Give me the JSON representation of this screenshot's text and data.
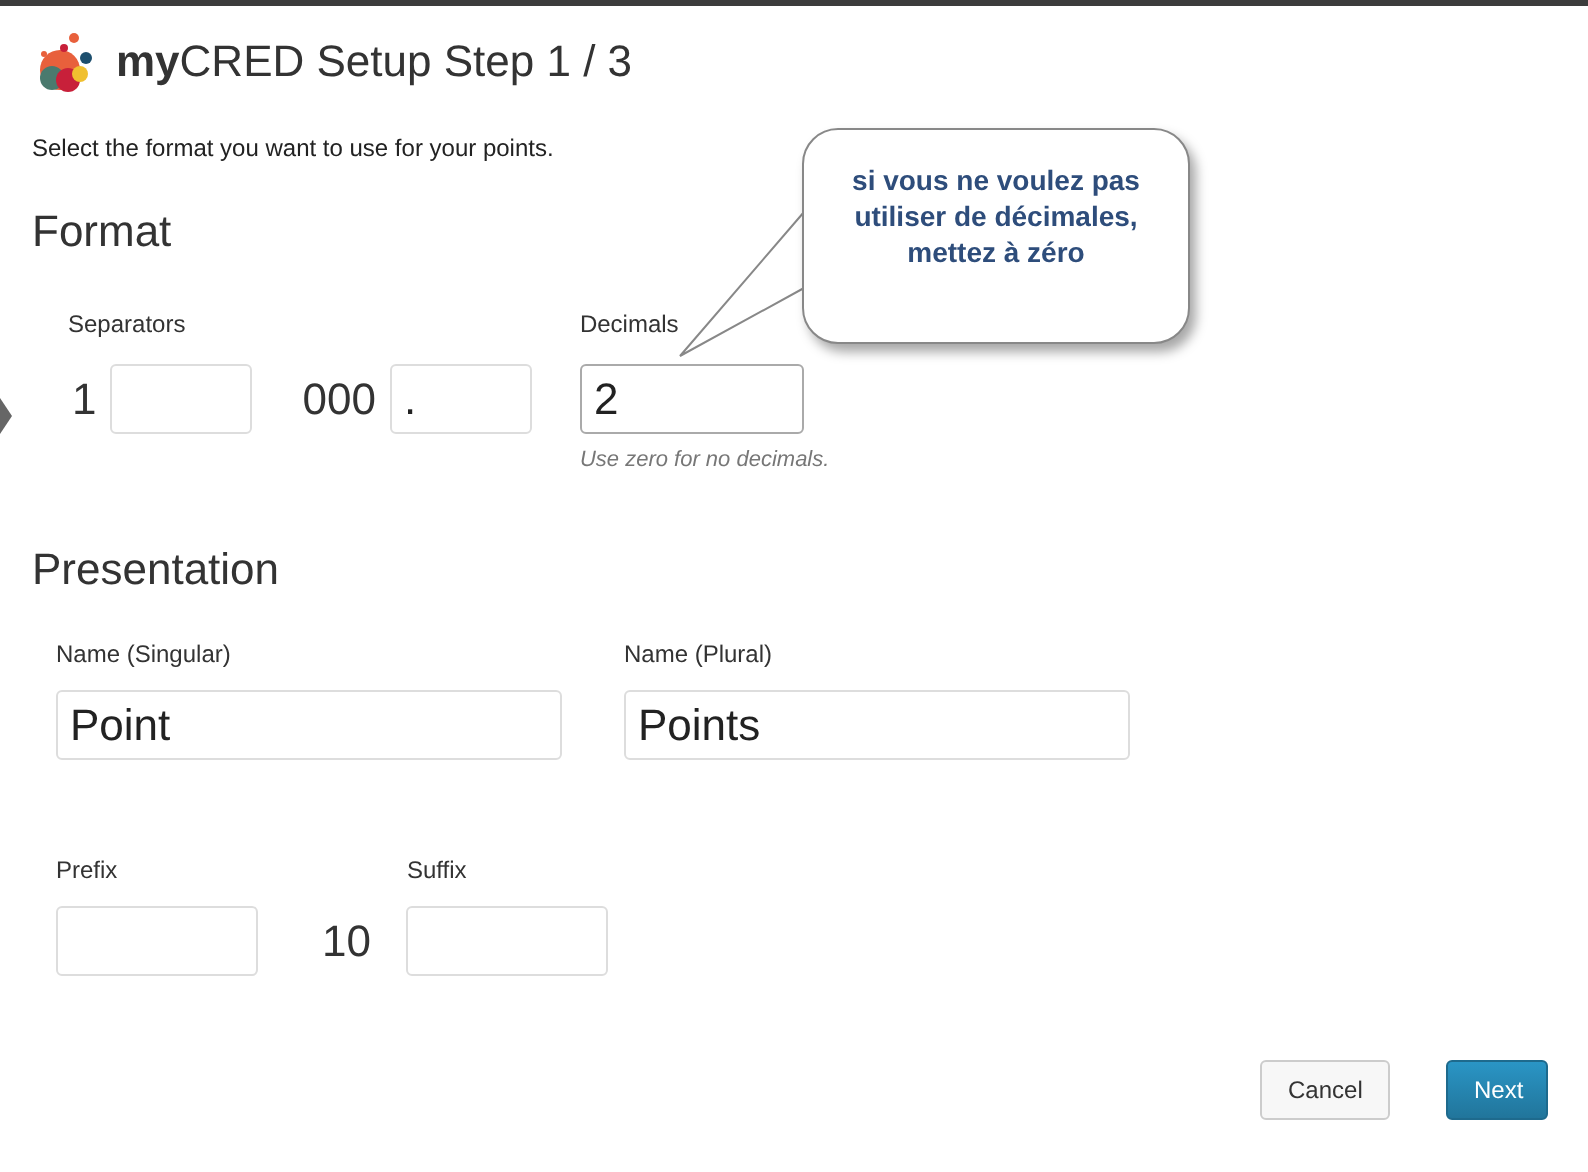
{
  "title": "**my**CRED Setup Step 1 / 3",
  "intro": "Select the format you want to use for your points.",
  "format": {
    "heading": "Format",
    "separators_label": "Separators",
    "thousands_sample": "1",
    "decimal_sample": "000",
    "decimal_field": {
      "value": "."
    },
    "decimals_label": "Decimals",
    "decimals_field": {
      "value": "2"
    },
    "decimals_hint": "Use zero for no decimals."
  },
  "callout": {
    "text": "si vous ne voulez pas utiliser de décimales, mettez à zéro"
  },
  "presentation": {
    "heading": "Presentation",
    "singular": {
      "label": "Name (Singular)",
      "value": "Point"
    },
    "plural": {
      "label": "Name (Plural)",
      "value": "Points"
    },
    "prefix": {
      "label": "Prefix"
    },
    "sample": "10",
    "suffix": {
      "label": "Suffix"
    }
  },
  "buttons": [
    {
      "label": "Cancel",
      "kind": "secondary"
    },
    {
      "label": "Next",
      "kind": "primary"
    }
  ]
}
